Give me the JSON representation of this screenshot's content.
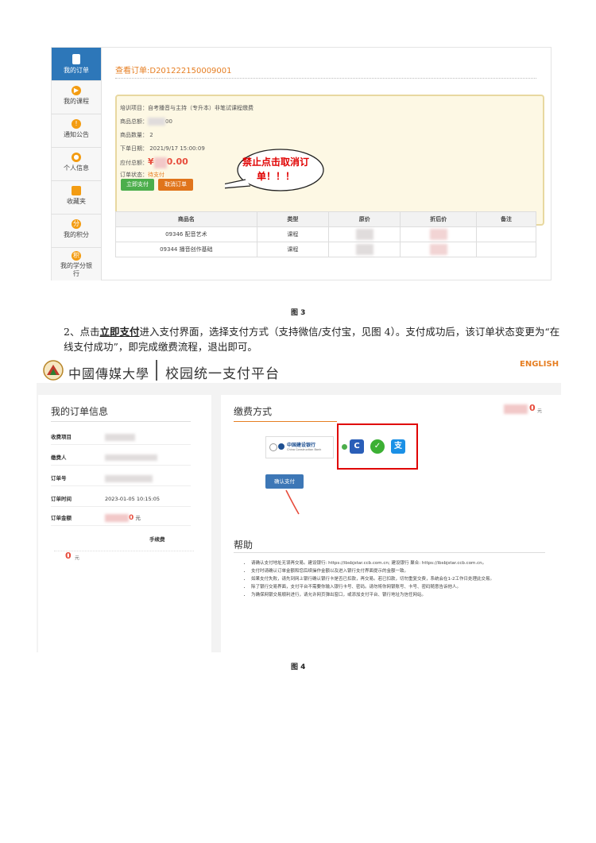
{
  "figure3": {
    "sidebar": [
      {
        "label": "我的订单",
        "icon": "document-icon",
        "active": true
      },
      {
        "label": "我的课程",
        "icon": "play-circle-icon"
      },
      {
        "label": "通知公告",
        "icon": "alert-circle-icon"
      },
      {
        "label": "个人信息",
        "icon": "user-circle-icon"
      },
      {
        "label": "收藏夹",
        "icon": "folder-icon"
      },
      {
        "label": "我的积分",
        "icon": "points-icon"
      },
      {
        "label": "我的学分银行",
        "icon": "credit-bank-icon"
      }
    ],
    "order_title": "查看订单:D201222150009001",
    "training_project": "培训项目：自考播音与主持（专升本）非笔试课程缴费",
    "goods_total_label": "商品总额：",
    "goods_total_tail": "00",
    "goods_qty": "商品数量： 2",
    "order_date": "下单日期： 2021/9/17 15:00:09",
    "payable_label": "应付总额：",
    "payable_prefix": "¥",
    "payable_tail": "0.00",
    "order_status_label": "订单状态：",
    "order_status": "待支付",
    "pay_now": "立即支付",
    "cancel_order": "取消订单",
    "callout": "禁止点击取消订单！！！",
    "table_headers": [
      "商品名",
      "类型",
      "原价",
      "折后价",
      "备注"
    ],
    "table_rows": [
      {
        "name": "09346 配音艺术",
        "type": "课程"
      },
      {
        "name": "09344 播音创作基础",
        "type": "课程"
      }
    ]
  },
  "caption3": "图 3",
  "paragraph": {
    "part1": "2、点击",
    "highlight": "立即支付",
    "part2": "进入支付界面，选择支付方式（支持微信/支付宝，见图 4）。支付成功后，该订单状态变更为“在线支付成功”，即完成缴费流程，退出即可。"
  },
  "figure4": {
    "school_name": "中國傳媒大學",
    "platform_name": "校园统一支付平台",
    "english": "ENGLISH",
    "left_title": "我的订单信息",
    "rows": [
      {
        "label": "收费项目",
        "value": ""
      },
      {
        "label": "缴费人",
        "value": ""
      },
      {
        "label": "订单号",
        "value": ""
      },
      {
        "label": "订单时间",
        "value": "2023-01-05 10:15:05"
      },
      {
        "label": "订单金额",
        "value": "0",
        "unit": "元"
      }
    ],
    "fee_label": "手续费",
    "fee_value": "0",
    "fee_unit": "元",
    "right_title": "缴费方式",
    "right_amount_tail": "0",
    "right_amount_unit": "元",
    "bank_name": "中国建设银行",
    "bank_sub": "China Construction Bank",
    "confirm_button": "确认支付",
    "help_title": "帮助",
    "help_items": [
      "请确认支付地址无误再交易。建设银行: https://ibsbjstar.ccb.com.cn; 建设银行 聚合: https://ibsbjstar.ccb.com.cn。",
      "支付时请确认订单金额和您后续操作金额以及进入银行支付界面提示的金额一致。",
      "如果支付失败，请先到网上银行确认银行卡是否已扣款，再交易。若已扣款，切勿重复交费，系统会在1-2工作日处理此交易。",
      "除了银行交易界面，支付平台不需要你输入银行卡号、密码。请勿将你网银账号、卡号、密码随意告诉他人。",
      "为确保网银交易顺利进行，请允许网页弹出窗口，或添加支付平台、银行地址为信任网站。"
    ]
  },
  "caption4": "图 4",
  "colors": {
    "accent_blue": "#2d77b9",
    "orange": "#e67e22",
    "red": "#e00000",
    "green": "#4cae4c"
  }
}
